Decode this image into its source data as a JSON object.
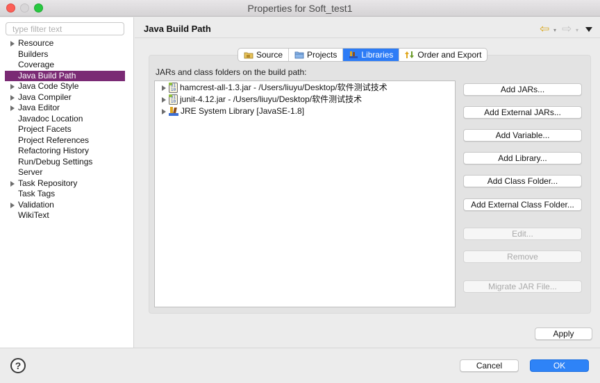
{
  "window": {
    "title": "Properties for Soft_test1"
  },
  "sidebar": {
    "filter_placeholder": "type filter text",
    "items": [
      {
        "label": "Resource",
        "expandable": true
      },
      {
        "label": "Builders",
        "expandable": false
      },
      {
        "label": "Coverage",
        "expandable": false
      },
      {
        "label": "Java Build Path",
        "expandable": false,
        "selected": true
      },
      {
        "label": "Java Code Style",
        "expandable": true
      },
      {
        "label": "Java Compiler",
        "expandable": true
      },
      {
        "label": "Java Editor",
        "expandable": true
      },
      {
        "label": "Javadoc Location",
        "expandable": false
      },
      {
        "label": "Project Facets",
        "expandable": false
      },
      {
        "label": "Project References",
        "expandable": false
      },
      {
        "label": "Refactoring History",
        "expandable": false
      },
      {
        "label": "Run/Debug Settings",
        "expandable": false
      },
      {
        "label": "Server",
        "expandable": false
      },
      {
        "label": "Task Repository",
        "expandable": true
      },
      {
        "label": "Task Tags",
        "expandable": false
      },
      {
        "label": "Validation",
        "expandable": true
      },
      {
        "label": "WikiText",
        "expandable": false
      }
    ]
  },
  "header": {
    "title": "Java Build Path"
  },
  "tabs": [
    {
      "label": "Source",
      "icon": "source-folder-icon"
    },
    {
      "label": "Projects",
      "icon": "projects-icon"
    },
    {
      "label": "Libraries",
      "icon": "libraries-icon",
      "active": true
    },
    {
      "label": "Order and Export",
      "icon": "order-export-icon"
    }
  ],
  "libraries": {
    "label": "JARs and class folders on the build path:",
    "items": [
      {
        "label": "hamcrest-all-1.3.jar - /Users/liuyu/Desktop/软件测试技术",
        "icon": "jar-icon"
      },
      {
        "label": "junit-4.12.jar - /Users/liuyu/Desktop/软件测试技术",
        "icon": "jar-icon"
      },
      {
        "label": "JRE System Library [JavaSE-1.8]",
        "icon": "library-icon"
      }
    ]
  },
  "buttons": {
    "add_jars": "Add JARs...",
    "add_external_jars": "Add External JARs...",
    "add_variable": "Add Variable...",
    "add_library": "Add Library...",
    "add_class_folder": "Add Class Folder...",
    "add_external_class_folder": "Add External Class Folder...",
    "edit": "Edit...",
    "remove": "Remove",
    "migrate_jar": "Migrate JAR File...",
    "apply": "Apply",
    "cancel": "Cancel",
    "ok": "OK"
  },
  "colors": {
    "selection": "#7a2a74",
    "accent": "#2e83f7"
  }
}
